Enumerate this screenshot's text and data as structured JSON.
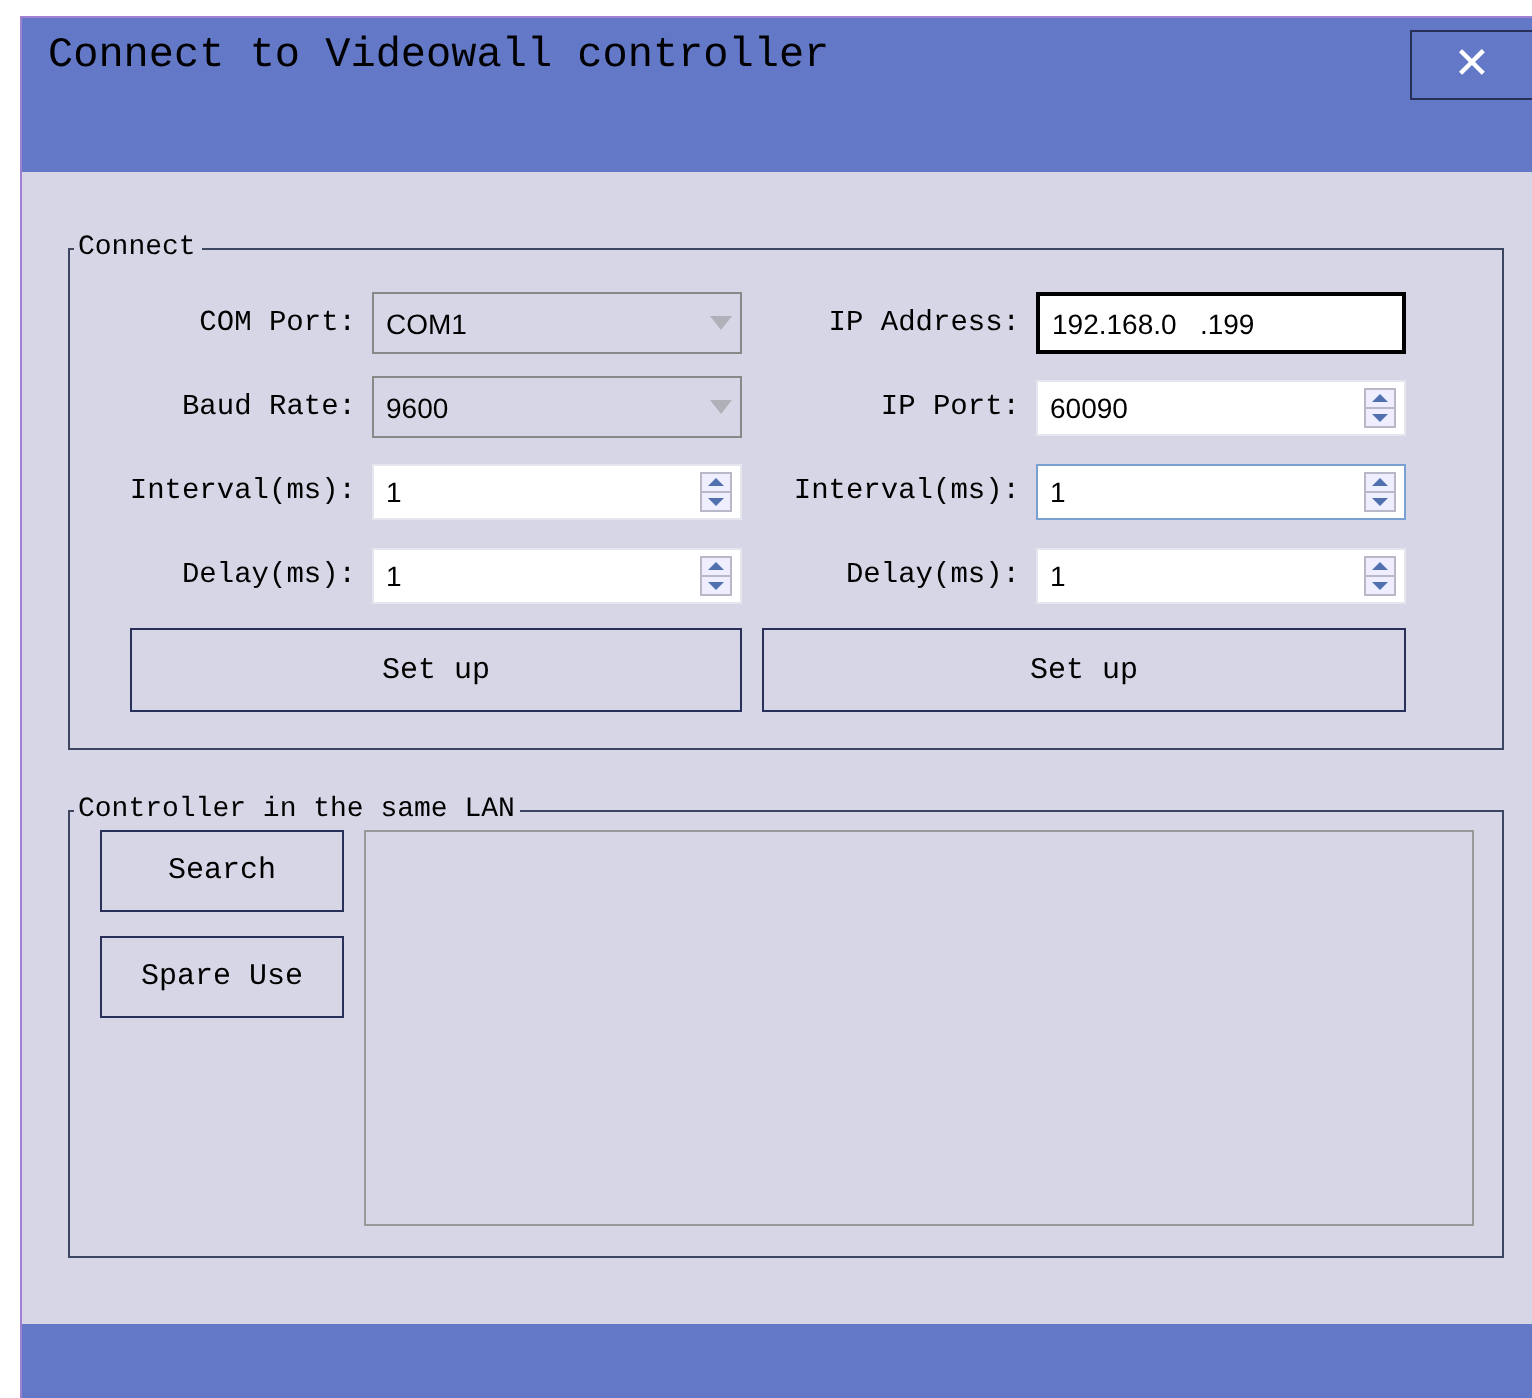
{
  "window": {
    "title": "Connect to Videowall controller",
    "close": "✕"
  },
  "connect": {
    "legend": "Connect",
    "columns": [
      {
        "fields": [
          {
            "label": "COM Port:",
            "kind": "combo",
            "value": "COM1",
            "focused": false
          },
          {
            "label": "Baud Rate:",
            "kind": "combo",
            "value": "9600",
            "focused": false
          },
          {
            "label": "Interval(ms):",
            "kind": "spin",
            "value": "1",
            "focused": false
          },
          {
            "label": "Delay(ms):",
            "kind": "spin",
            "value": "1",
            "focused": false
          }
        ],
        "button": "Set up"
      },
      {
        "fields": [
          {
            "label": "IP Address:",
            "kind": "ip",
            "value": "192.168.0   .199",
            "focused": false
          },
          {
            "label": "IP Port:",
            "kind": "spin",
            "value": "60090",
            "focused": false
          },
          {
            "label": "Interval(ms):",
            "kind": "spin",
            "value": "1",
            "focused": true
          },
          {
            "label": "Delay(ms):",
            "kind": "spin",
            "value": "1",
            "focused": false
          }
        ],
        "button": "Set up"
      }
    ]
  },
  "lan": {
    "legend": "Controller in the same LAN",
    "buttons": [
      "Search",
      "Spare Use"
    ]
  }
}
